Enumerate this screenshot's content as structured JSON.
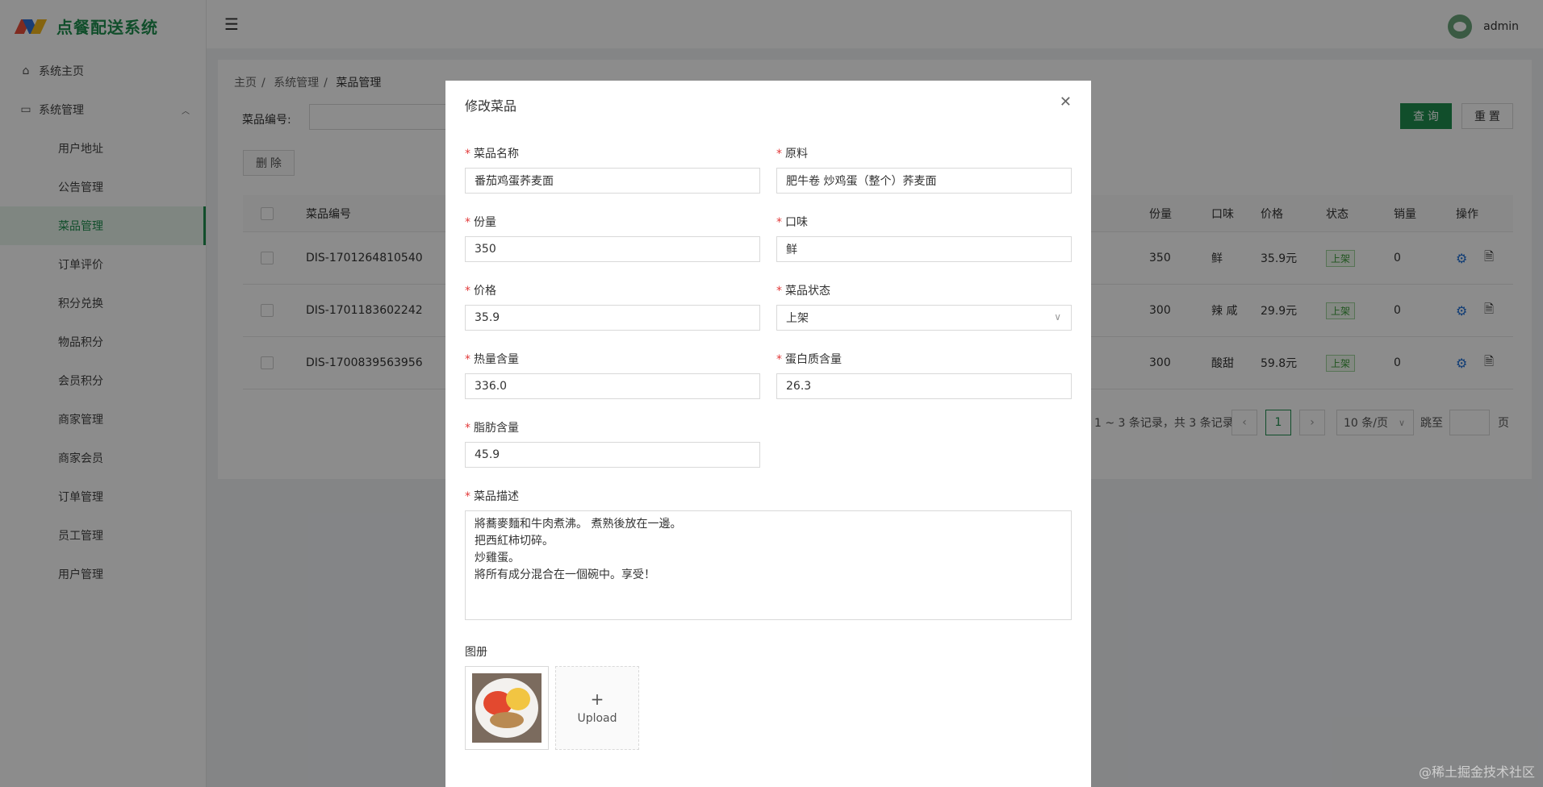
{
  "app": {
    "logo_text": "点餐配送系统"
  },
  "sidebar": {
    "items": [
      {
        "label": "系统主页",
        "icon": "home-icon"
      },
      {
        "label": "系统管理",
        "icon": "monitor-icon"
      }
    ],
    "sub_items": [
      "用户地址",
      "公告管理",
      "菜品管理",
      "订单评价",
      "积分兑换",
      "物品积分",
      "会员积分",
      "商家管理",
      "商家会员",
      "订单管理",
      "员工管理",
      "用户管理"
    ],
    "active": "菜品管理"
  },
  "header": {
    "username": "admin"
  },
  "breadcrumb": [
    "主页",
    "系统管理",
    "菜品管理"
  ],
  "search": {
    "label": "菜品编号:",
    "value": ""
  },
  "toolbar": {
    "query_label": "查 询",
    "reset_label": "重 置",
    "delete_label": "删 除"
  },
  "table": {
    "columns": {
      "code": "菜品编号",
      "portion": "份量",
      "taste": "口味",
      "price": "价格",
      "status": "状态",
      "sales": "销量",
      "ops": "操作"
    },
    "rows": [
      {
        "code": "DIS-1701264810540",
        "portion": "350",
        "taste": "鲜",
        "price": "35.9元",
        "status": "上架",
        "sales": "0"
      },
      {
        "code": "DIS-1701183602242",
        "portion": "300",
        "taste": "辣 咸",
        "price": "29.9元",
        "status": "上架",
        "sales": "0"
      },
      {
        "code": "DIS-1700839563956",
        "portion": "300",
        "taste": "酸甜",
        "price": "59.8元",
        "status": "上架",
        "sales": "0"
      }
    ]
  },
  "pagination": {
    "summary": "1 ~ 3 条记录，共 3 条记录",
    "current": "1",
    "page_size": "10 条/页",
    "jump_label": "跳至",
    "page_suffix": "页"
  },
  "modal": {
    "title": "修改菜品",
    "fields": {
      "name": {
        "label": "菜品名称",
        "value": "番茄鸡蛋荞麦面"
      },
      "ingredients": {
        "label": "原料",
        "value": "肥牛卷 炒鸡蛋（整个）荞麦面"
      },
      "portion": {
        "label": "份量",
        "value": "350"
      },
      "taste": {
        "label": "口味",
        "value": "鲜"
      },
      "price": {
        "label": "价格",
        "value": "35.9"
      },
      "status": {
        "label": "菜品状态",
        "value": "上架"
      },
      "calories": {
        "label": "热量含量",
        "value": "336.0"
      },
      "protein": {
        "label": "蛋白质含量",
        "value": "26.3"
      },
      "fat": {
        "label": "脂肪含量",
        "value": "45.9"
      },
      "description": {
        "label": "菜品描述",
        "value": "將蕎麥麵和牛肉煮沸。 煮熟後放在一邊。\n把西紅柿切碎。\n炒雞蛋。\n將所有成分混合在一個碗中。享受！"
      }
    },
    "gallery": {
      "label": "图册",
      "upload_label": "Upload"
    }
  },
  "watermark": "@稀土掘金技术社区",
  "colors": {
    "brand": "#1f8f4f",
    "required": "#e23a3a",
    "status_tag": "#3b9a3a",
    "op_icon": "#1f6fd6"
  }
}
